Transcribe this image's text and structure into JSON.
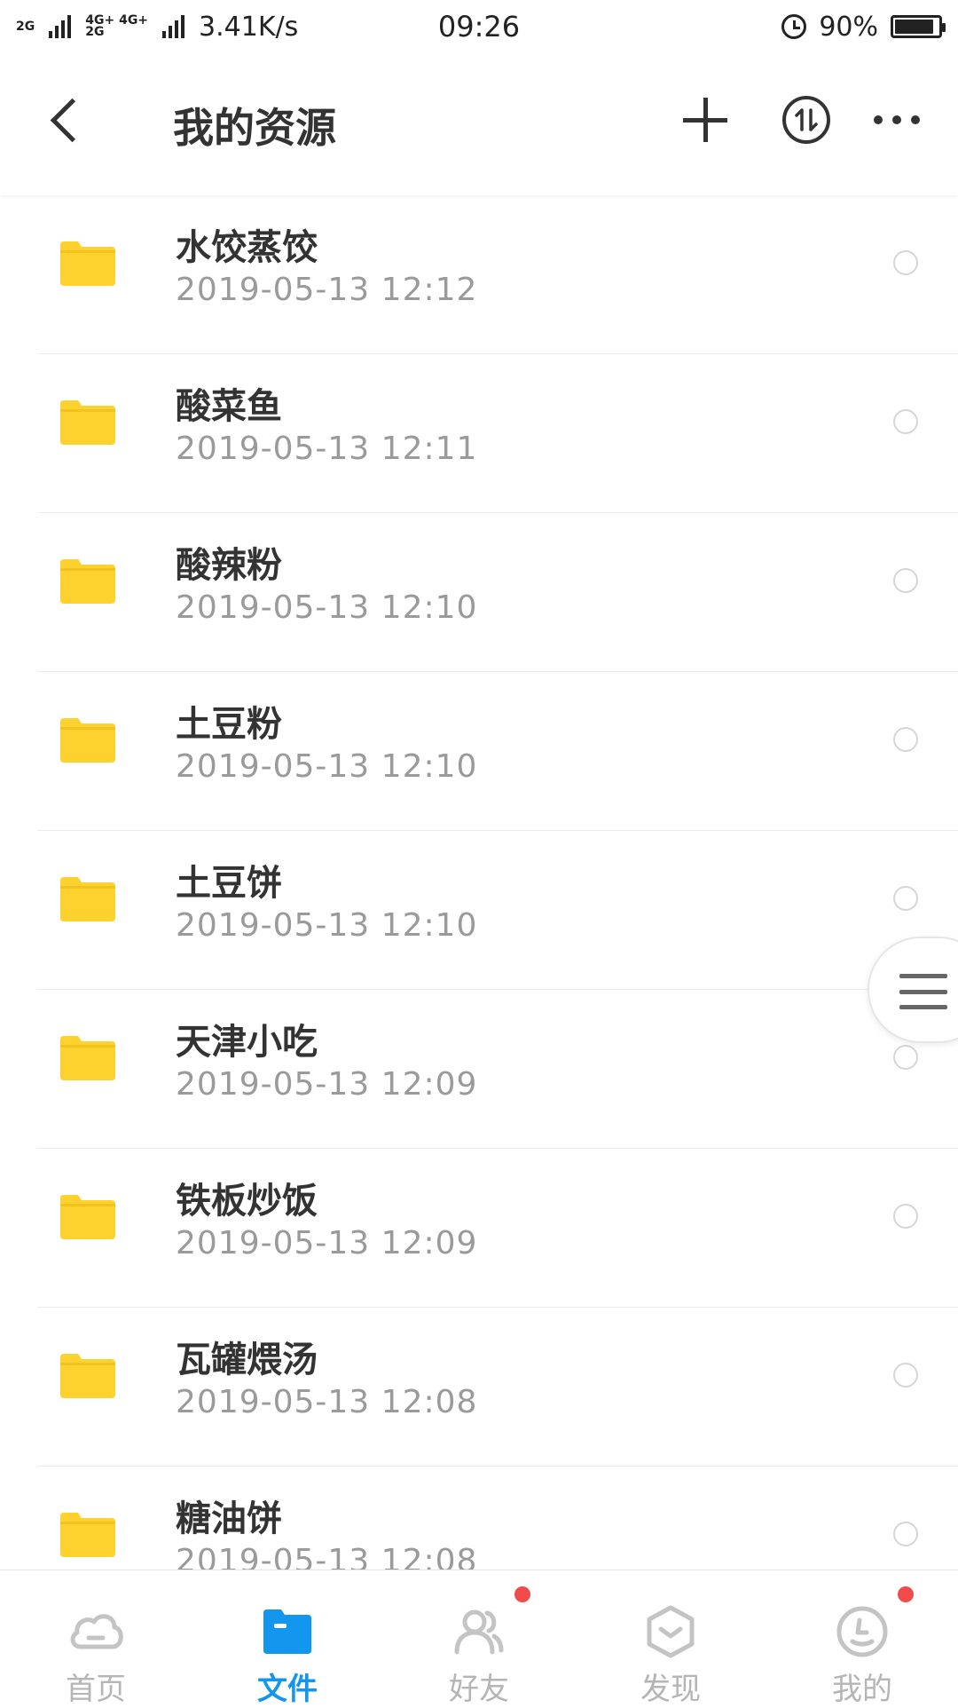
{
  "status_bar": {
    "network_left": "2G",
    "network_mid_top": "4G+ 4G+",
    "network_mid_bottom": "2G",
    "speed": "3.41K/s",
    "time": "09:26",
    "battery": "90%",
    "battery_level": 0.9
  },
  "appbar": {
    "title": "我的资源"
  },
  "files": [
    {
      "name": "水饺蒸饺",
      "date": "2019-05-13  12:12"
    },
    {
      "name": "酸菜鱼",
      "date": "2019-05-13  12:11"
    },
    {
      "name": "酸辣粉",
      "date": "2019-05-13  12:10"
    },
    {
      "name": "土豆粉",
      "date": "2019-05-13  12:10"
    },
    {
      "name": "土豆饼",
      "date": "2019-05-13  12:10"
    },
    {
      "name": "天津小吃",
      "date": "2019-05-13  12:09"
    },
    {
      "name": "铁板炒饭",
      "date": "2019-05-13  12:09"
    },
    {
      "name": "瓦罐煨汤",
      "date": "2019-05-13  12:08"
    },
    {
      "name": "糖油饼",
      "date": "2019-05-13  12:08"
    }
  ],
  "bottom_nav": {
    "home": "首页",
    "files": "文件",
    "friends": "好友",
    "discover": "发现",
    "mine": "我的"
  },
  "colors": {
    "accent": "#1296ee",
    "folder": "#fdd22f",
    "badge": "#f24b4b"
  }
}
